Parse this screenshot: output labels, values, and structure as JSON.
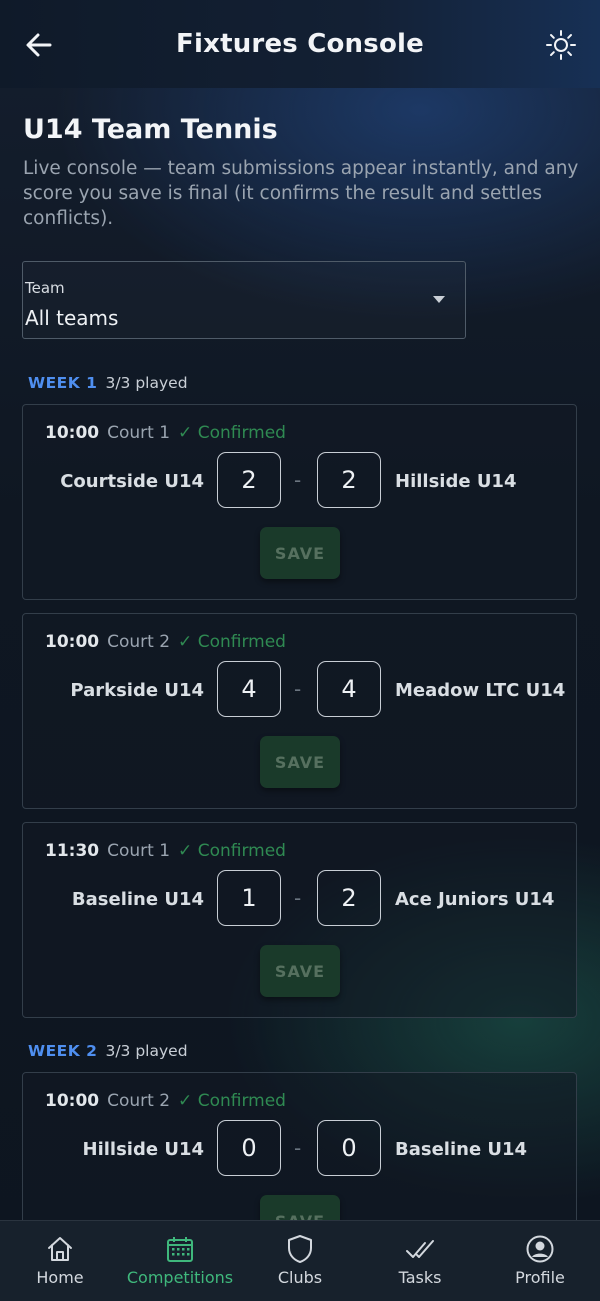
{
  "header": {
    "title": "Fixtures Console",
    "back_icon": "arrow-left-icon",
    "theme_icon": "sun-icon"
  },
  "page": {
    "title": "U14 Team Tennis",
    "subtitle": "Live console — team submissions appear instantly, and any score you save is final (it confirms the result and settles conflicts)."
  },
  "filter": {
    "label": "Team",
    "value": "All teams"
  },
  "weeks": [
    {
      "label": "WEEK 1",
      "played": "3/3 played",
      "matches": [
        {
          "time": "10:00",
          "court": "Court 1",
          "status": "✓ Confirmed",
          "home": "Courtside U14",
          "home_score": "2",
          "away_score": "2",
          "away": "Hillside U14",
          "save": "SAVE"
        },
        {
          "time": "10:00",
          "court": "Court 2",
          "status": "✓ Confirmed",
          "home": "Parkside U14",
          "home_score": "4",
          "away_score": "4",
          "away": "Meadow LTC U14",
          "save": "SAVE"
        },
        {
          "time": "11:30",
          "court": "Court 1",
          "status": "✓ Confirmed",
          "home": "Baseline U14",
          "home_score": "1",
          "away_score": "2",
          "away": "Ace Juniors U14",
          "save": "SAVE"
        }
      ]
    },
    {
      "label": "WEEK 2",
      "played": "3/3 played",
      "matches": [
        {
          "time": "10:00",
          "court": "Court 2",
          "status": "✓ Confirmed",
          "home": "Hillside U14",
          "home_score": "0",
          "away_score": "0",
          "away": "Baseline U14",
          "save": "SAVE"
        }
      ]
    }
  ],
  "nav": [
    {
      "label": "Home",
      "icon": "home-icon"
    },
    {
      "label": "Competitions",
      "icon": "calendar-icon",
      "active": true
    },
    {
      "label": "Clubs",
      "icon": "shield-icon"
    },
    {
      "label": "Tasks",
      "icon": "double-check-icon"
    },
    {
      "label": "Profile",
      "icon": "user-circle-icon"
    }
  ],
  "colors": {
    "accent_green": "#3fb87c",
    "week_blue": "#4f8ff0",
    "confirmed_green": "#2f8a52"
  }
}
